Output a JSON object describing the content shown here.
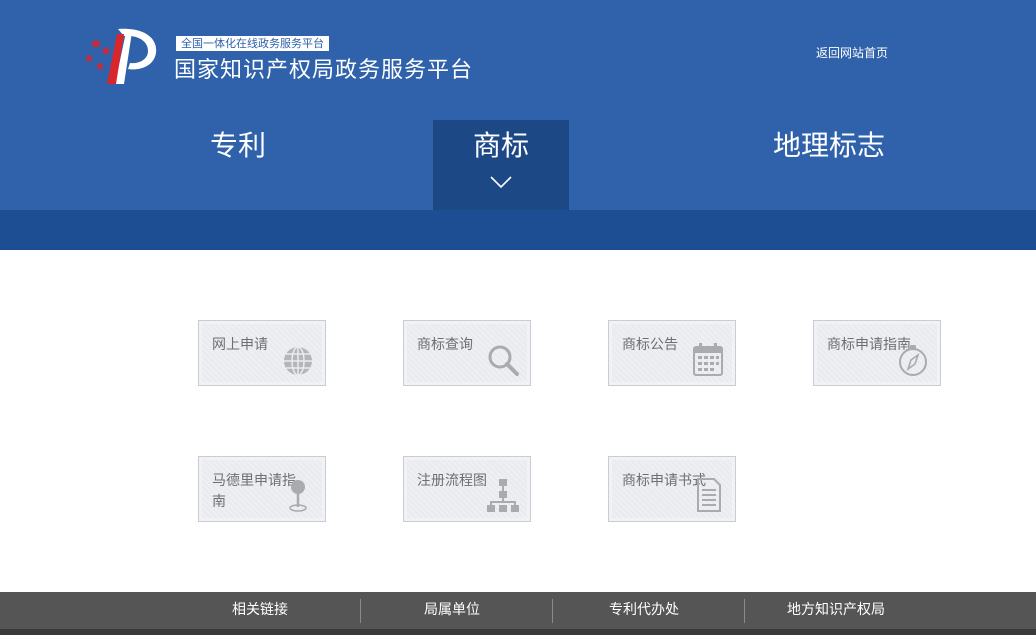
{
  "header": {
    "tagline": "全国一体化在线政务服务平台",
    "title": "国家知识产权局政务服务平台",
    "home_link": "返回网站首页",
    "colors": {
      "primary": "#2f62ab",
      "dark": "#1d4e94",
      "active_tab": "#1d4886"
    }
  },
  "nav": {
    "tabs": [
      {
        "label": "专利",
        "active": false
      },
      {
        "label": "商标",
        "active": true
      },
      {
        "label": "地理标志",
        "active": false
      }
    ]
  },
  "tiles": [
    {
      "label": "网上申请",
      "icon": "globe-icon"
    },
    {
      "label": "商标查询",
      "icon": "magnifier-icon"
    },
    {
      "label": "商标公告",
      "icon": "calendar-icon"
    },
    {
      "label": "商标申请指南",
      "icon": "compass-icon"
    },
    {
      "label": "马德里申请指南",
      "icon": "map-pin-icon"
    },
    {
      "label": "注册流程图",
      "icon": "flowchart-icon"
    },
    {
      "label": "商标申请书式",
      "icon": "document-icon"
    }
  ],
  "footer": {
    "links": [
      "相关链接",
      "局属单位",
      "专利代办处",
      "地方知识产权局"
    ],
    "color": "#555555"
  }
}
